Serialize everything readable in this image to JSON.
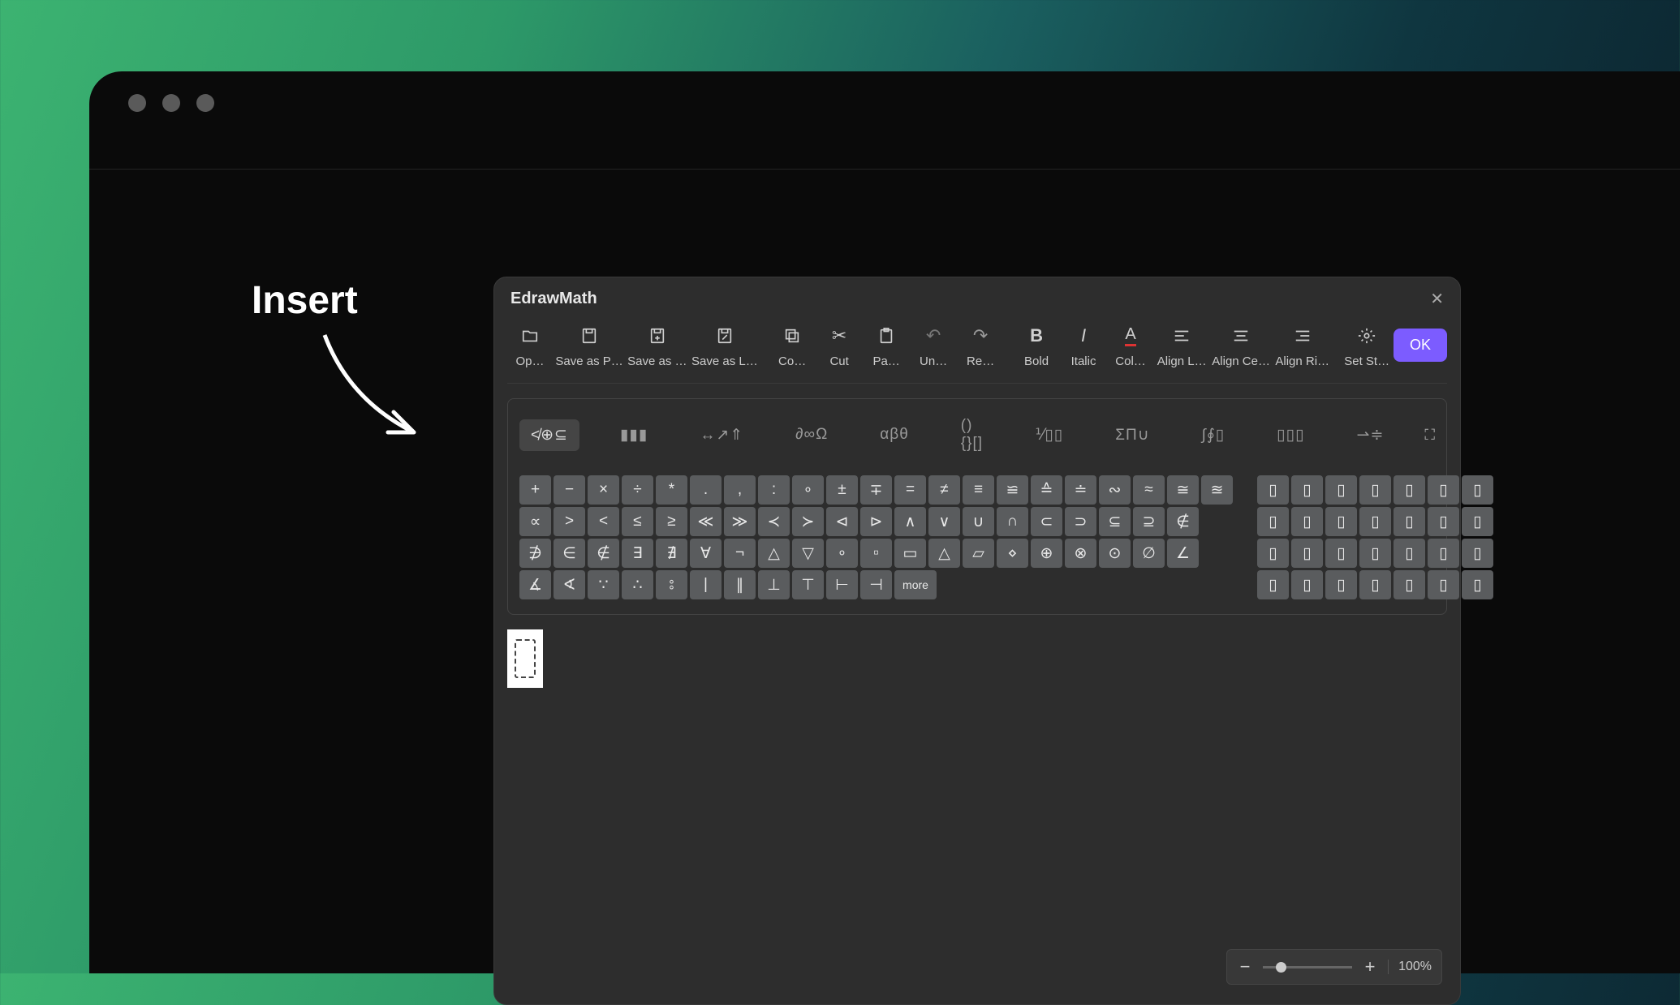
{
  "annotation": "Insert",
  "dialog": {
    "title": "EdrawMath",
    "ok_label": "OK"
  },
  "toolbar": [
    {
      "id": "open",
      "label": "Op…"
    },
    {
      "id": "save-png",
      "label": "Save as P…"
    },
    {
      "id": "save-as",
      "label": "Save as …"
    },
    {
      "id": "save-latex",
      "label": "Save as L…"
    },
    {
      "id": "copy",
      "label": "Co…"
    },
    {
      "id": "cut",
      "label": "Cut"
    },
    {
      "id": "paste",
      "label": "Pa…"
    },
    {
      "id": "undo",
      "label": "Un…"
    },
    {
      "id": "redo",
      "label": "Re…"
    },
    {
      "id": "bold",
      "label": "Bold"
    },
    {
      "id": "italic",
      "label": "Italic"
    },
    {
      "id": "color",
      "label": "Col…"
    },
    {
      "id": "align-left",
      "label": "Align L…"
    },
    {
      "id": "align-center",
      "label": "Align Ce…"
    },
    {
      "id": "align-right",
      "label": "Align Ri…"
    },
    {
      "id": "settings",
      "label": "Set St…"
    }
  ],
  "categories": [
    "≮⊕⊆",
    "▮▮▮",
    "↔↗⇑",
    "∂∞Ω",
    "αβθ",
    "(){}[]",
    "⅟▯▯",
    "ΣΠ∪",
    "∫∮▯",
    "▯▯▯",
    "⇀≑",
    "⛶"
  ],
  "symbol_grid": [
    [
      "+",
      "−",
      "×",
      "÷",
      "*",
      ".",
      ",",
      ":",
      "∘",
      "±",
      "∓",
      "=",
      "≠",
      "≡",
      "≌",
      "≙",
      "≐",
      "∾",
      "≈",
      "≅",
      "≊"
    ],
    [
      "∝",
      ">",
      "<",
      "≤",
      "≥",
      "≪",
      "≫",
      "≺",
      "≻",
      "⊲",
      "⊳",
      "∧",
      "∨",
      "∪",
      "∩",
      "⊂",
      "⊃",
      "⊆",
      "⊇",
      "∉"
    ],
    [
      "∌",
      "∈",
      "∉",
      "∃",
      "∄",
      "∀",
      "¬",
      "△",
      "▽",
      "∘",
      "▫",
      "▭",
      "△",
      "▱",
      "⋄",
      "⊕",
      "⊗",
      "⊙",
      "∅",
      "∠"
    ],
    [
      "∡",
      "∢",
      "∵",
      "∴",
      "⦂",
      "|",
      "∥",
      "⊥",
      "⊤",
      "⊢",
      "⊣",
      "more"
    ]
  ],
  "right_grid": [
    [
      "▯",
      "▯",
      "▯",
      "▯",
      "▯",
      "▯",
      "▯"
    ],
    [
      "▯",
      "▯",
      "▯",
      "▯",
      "▯",
      "▯",
      "▯"
    ],
    [
      "▯",
      "▯",
      "▯",
      "▯",
      "▯",
      "▯",
      "▯"
    ],
    [
      "▯",
      "▯",
      "▯",
      "▯",
      "▯",
      "▯",
      "▯"
    ]
  ],
  "zoom": {
    "value": "100%"
  }
}
